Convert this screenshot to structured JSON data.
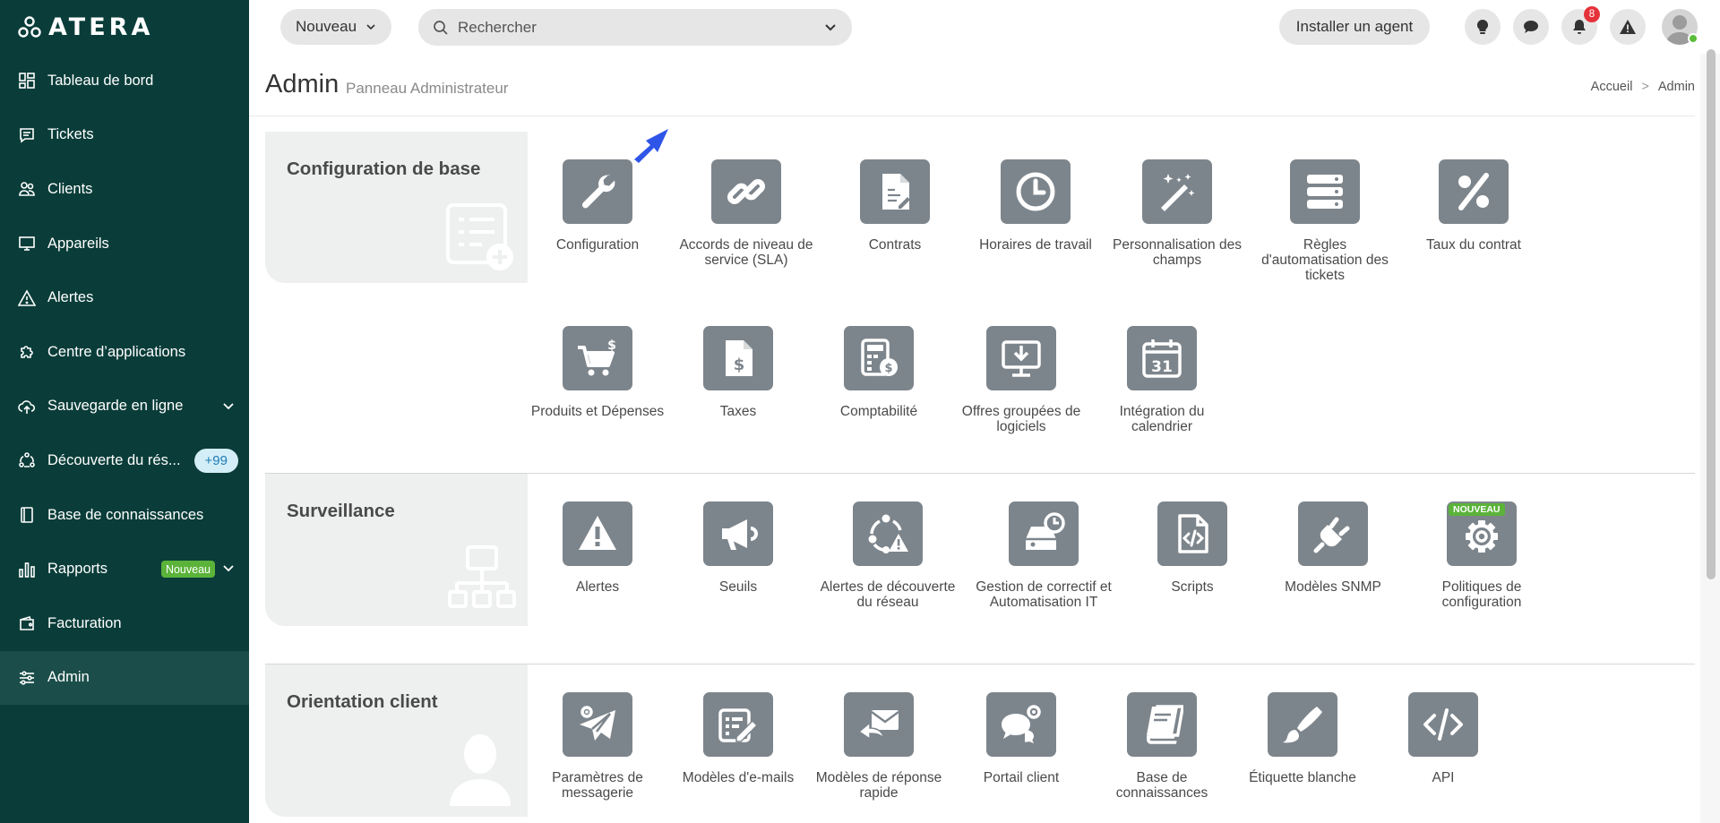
{
  "brand": {
    "logo_text": "ATERA"
  },
  "sidebar": {
    "items": [
      {
        "label": "Tableau de bord",
        "icon": "dashboard-icon"
      },
      {
        "label": "Tickets",
        "icon": "ticket-icon"
      },
      {
        "label": "Clients",
        "icon": "clients-icon"
      },
      {
        "label": "Appareils",
        "icon": "monitor-icon"
      },
      {
        "label": "Alertes",
        "icon": "alert-icon"
      },
      {
        "label": "Centre d’applications",
        "icon": "puzzle-icon"
      },
      {
        "label": "Sauvegarde en ligne",
        "icon": "cloud-backup-icon"
      },
      {
        "label": "Découverte du rés...",
        "icon": "network-discovery-icon",
        "badge": "+99"
      },
      {
        "label": "Base de connaissances",
        "icon": "book-icon"
      },
      {
        "label": "Rapports",
        "icon": "chart-icon",
        "badge": "Nouveau"
      },
      {
        "label": "Facturation",
        "icon": "wallet-icon"
      },
      {
        "label": "Admin",
        "icon": "sliders-icon"
      }
    ]
  },
  "topbar": {
    "new_label": "Nouveau",
    "search_placeholder": "Rechercher",
    "install_agent_label": "Installer un agent",
    "notification_count": "8"
  },
  "header": {
    "title": "Admin",
    "subtitle": "Panneau Administrateur",
    "breadcrumb": [
      "Accueil",
      ">",
      "Admin"
    ]
  },
  "sections": {
    "base": {
      "title": "Configuration de base",
      "tiles": [
        "Configuration",
        "Accords de niveau de service (SLA)",
        "Contrats",
        "Horaires de travail",
        "Personnalisation des champs",
        "Règles d'automatisation des tickets",
        "Taux du contrat",
        "Produits et Dépenses",
        "Taxes",
        "Comptabilité",
        "Offres groupées de logiciels",
        "Intégration du calendrier"
      ]
    },
    "monitoring": {
      "title": "Surveillance",
      "tiles": [
        "Alertes",
        "Seuils",
        "Alertes de découverte du réseau",
        "Gestion de correctif et Automatisation IT",
        "Scripts",
        "Modèles SNMP",
        "Politiques de configuration"
      ],
      "new_tag": "NOUVEAU"
    },
    "client": {
      "title": "Orientation client",
      "tiles": [
        "Paramètres de messagerie",
        "Modèles d'e-mails",
        "Modèles de réponse rapide",
        "Portail client",
        "Base de connaissances",
        "Étiquette blanche",
        "API"
      ]
    }
  },
  "colors": {
    "sidebar_bg": "#0a3d39",
    "tile_bg": "#7d858c",
    "panel_bg": "#eef0f0",
    "accent_green": "#5bb33a",
    "notification_red": "#e5323a",
    "cursor_blue": "#2f55e8"
  }
}
